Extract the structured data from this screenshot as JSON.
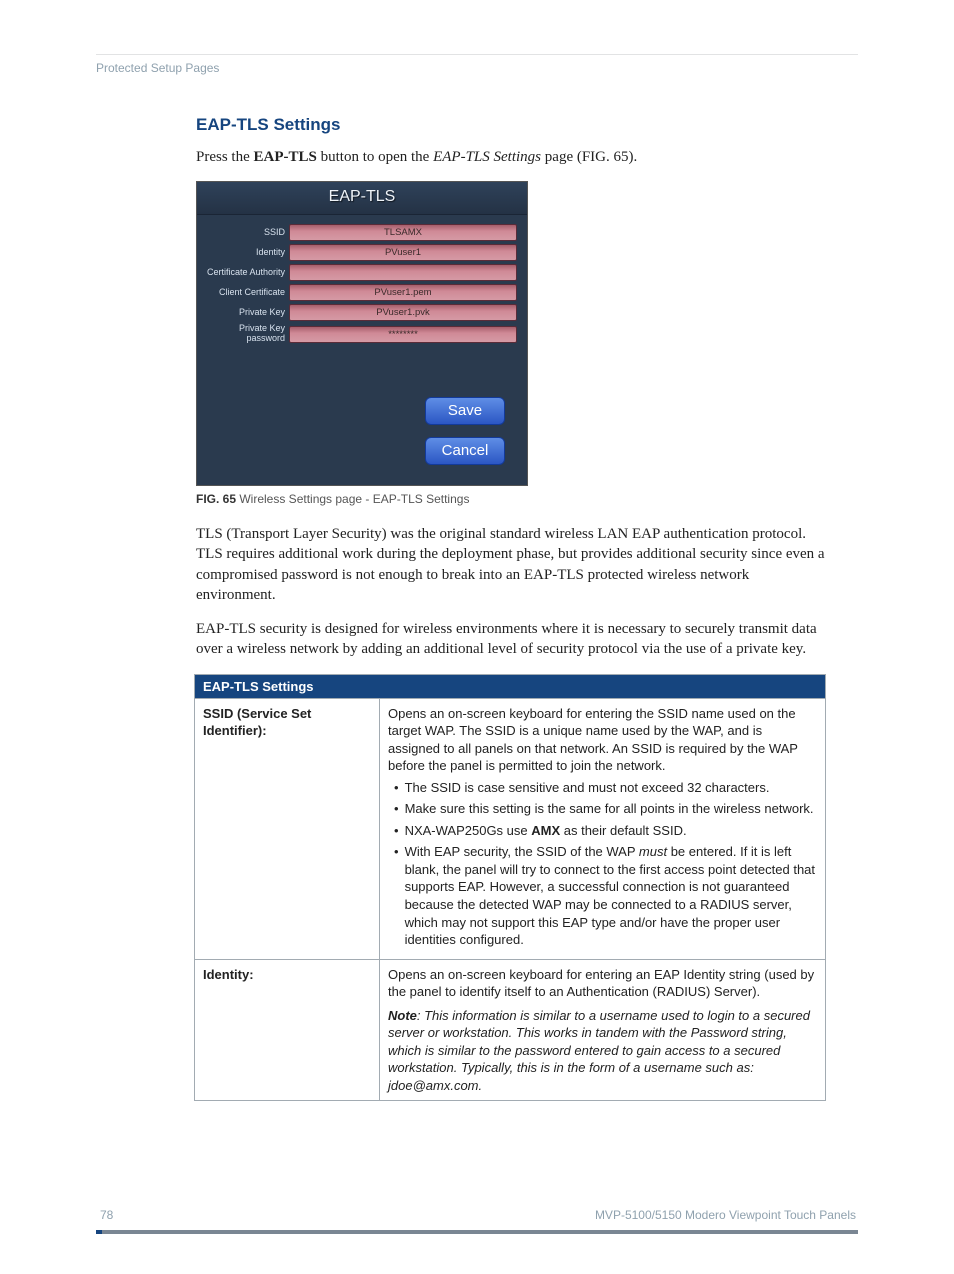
{
  "breadcrumb": "Protected Setup Pages",
  "section_title": "EAP-TLS Settings",
  "intro_pre": "Press the ",
  "intro_bold": "EAP-TLS",
  "intro_mid": " button to open the ",
  "intro_ital": "EAP-TLS Settings",
  "intro_post": " page (FIG. 65).",
  "shot": {
    "title": "EAP-TLS",
    "rows": {
      "ssid": {
        "label": "SSID",
        "value": "TLSAMX"
      },
      "identity": {
        "label": "Identity",
        "value": "PVuser1"
      },
      "ca": {
        "label": "Certificate Authority",
        "value": ""
      },
      "clientcert": {
        "label": "Client Certificate",
        "value": "PVuser1.pem"
      },
      "pk": {
        "label": "Private Key",
        "value": "PVuser1.pvk"
      },
      "pkpw": {
        "label": "Private Key password",
        "value": "********"
      }
    },
    "save": "Save",
    "cancel": "Cancel"
  },
  "caption_fig": "FIG. 65",
  "caption_text": "  Wireless Settings page - EAP-TLS Settings",
  "para1": "TLS (Transport Layer Security) was the original standard wireless LAN EAP authentication protocol. TLS requires additional work during the deployment phase, but provides additional security since even a compromised password is not enough to break into an EAP-TLS protected wireless network environment.",
  "para2": "EAP-TLS security is designed for wireless environments where it is necessary to securely transmit data over a wireless network by adding an additional level of security protocol via the use of a private key.",
  "table": {
    "header": "EAP-TLS Settings",
    "row_ssid": {
      "label": "SSID (Service Set Identifier):",
      "p1": "Opens an on-screen keyboard for entering the SSID name used on the target WAP. The SSID is a unique name used by the WAP, and is assigned to all panels on that network. An SSID is required by the WAP before the panel is permitted to join the network.",
      "b1": "The SSID is case sensitive and must not exceed 32 characters.",
      "b2": "Make sure this setting is the same for all points in the wireless network.",
      "b3_pre": "NXA-WAP250Gs use ",
      "b3_bold": "AMX",
      "b3_post": " as their default SSID.",
      "b4_pre": "With EAP security, the SSID of the WAP ",
      "b4_ital": "must",
      "b4_post": " be entered. If it is left blank, the panel will try to connect to the first access point detected that supports EAP. However, a successful connection is not guaranteed because the detected WAP may be connected to a RADIUS server, which may not support this EAP type and/or have the proper user identities configured."
    },
    "row_identity": {
      "label": "Identity:",
      "p1": "Opens an on-screen keyboard for entering an EAP Identity string (used by the panel to identify itself to an Authentication (RADIUS) Server).",
      "note_bold": "Note",
      "note_rest": ": This information is similar to a username used to login to a secured server or workstation. This works in tandem with the Password string, which is similar to the password entered to gain access to a secured workstation. Typically, this is in the form of a username such as: jdoe@amx.com."
    }
  },
  "footer": {
    "page": "78",
    "product": "MVP-5100/5150 Modero Viewpoint  Touch Panels"
  }
}
